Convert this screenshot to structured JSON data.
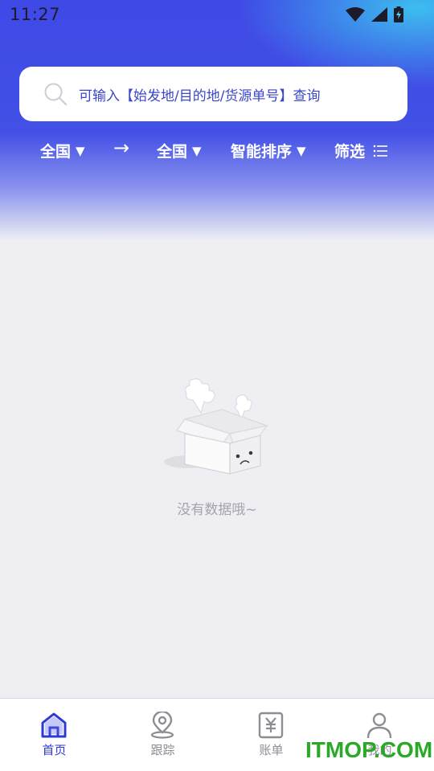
{
  "status_bar": {
    "time": "11:27"
  },
  "search": {
    "placeholder": "可输入【始发地/目的地/货源单号】查询"
  },
  "filters": {
    "origin": "全国",
    "arrow": "→",
    "destination": "全国",
    "sort": "智能排序",
    "filter": "筛选",
    "caret": "▼"
  },
  "empty_state": {
    "message": "没有数据哦~"
  },
  "tab_bar": {
    "items": [
      {
        "label": "首页",
        "icon": "home-icon",
        "active": true
      },
      {
        "label": "跟踪",
        "icon": "location-pin-icon",
        "active": false
      },
      {
        "label": "账单",
        "icon": "yuan-bill-icon",
        "active": false
      },
      {
        "label": "我的",
        "icon": "user-icon",
        "active": false
      }
    ]
  },
  "watermark": "ITMOP.COM",
  "colors": {
    "primary": "#3f49e6",
    "accent_cyan": "#3cd2f0",
    "background": "#efeff3",
    "active_tab": "#2f3ad6",
    "inactive_tab": "#8d8d94"
  }
}
